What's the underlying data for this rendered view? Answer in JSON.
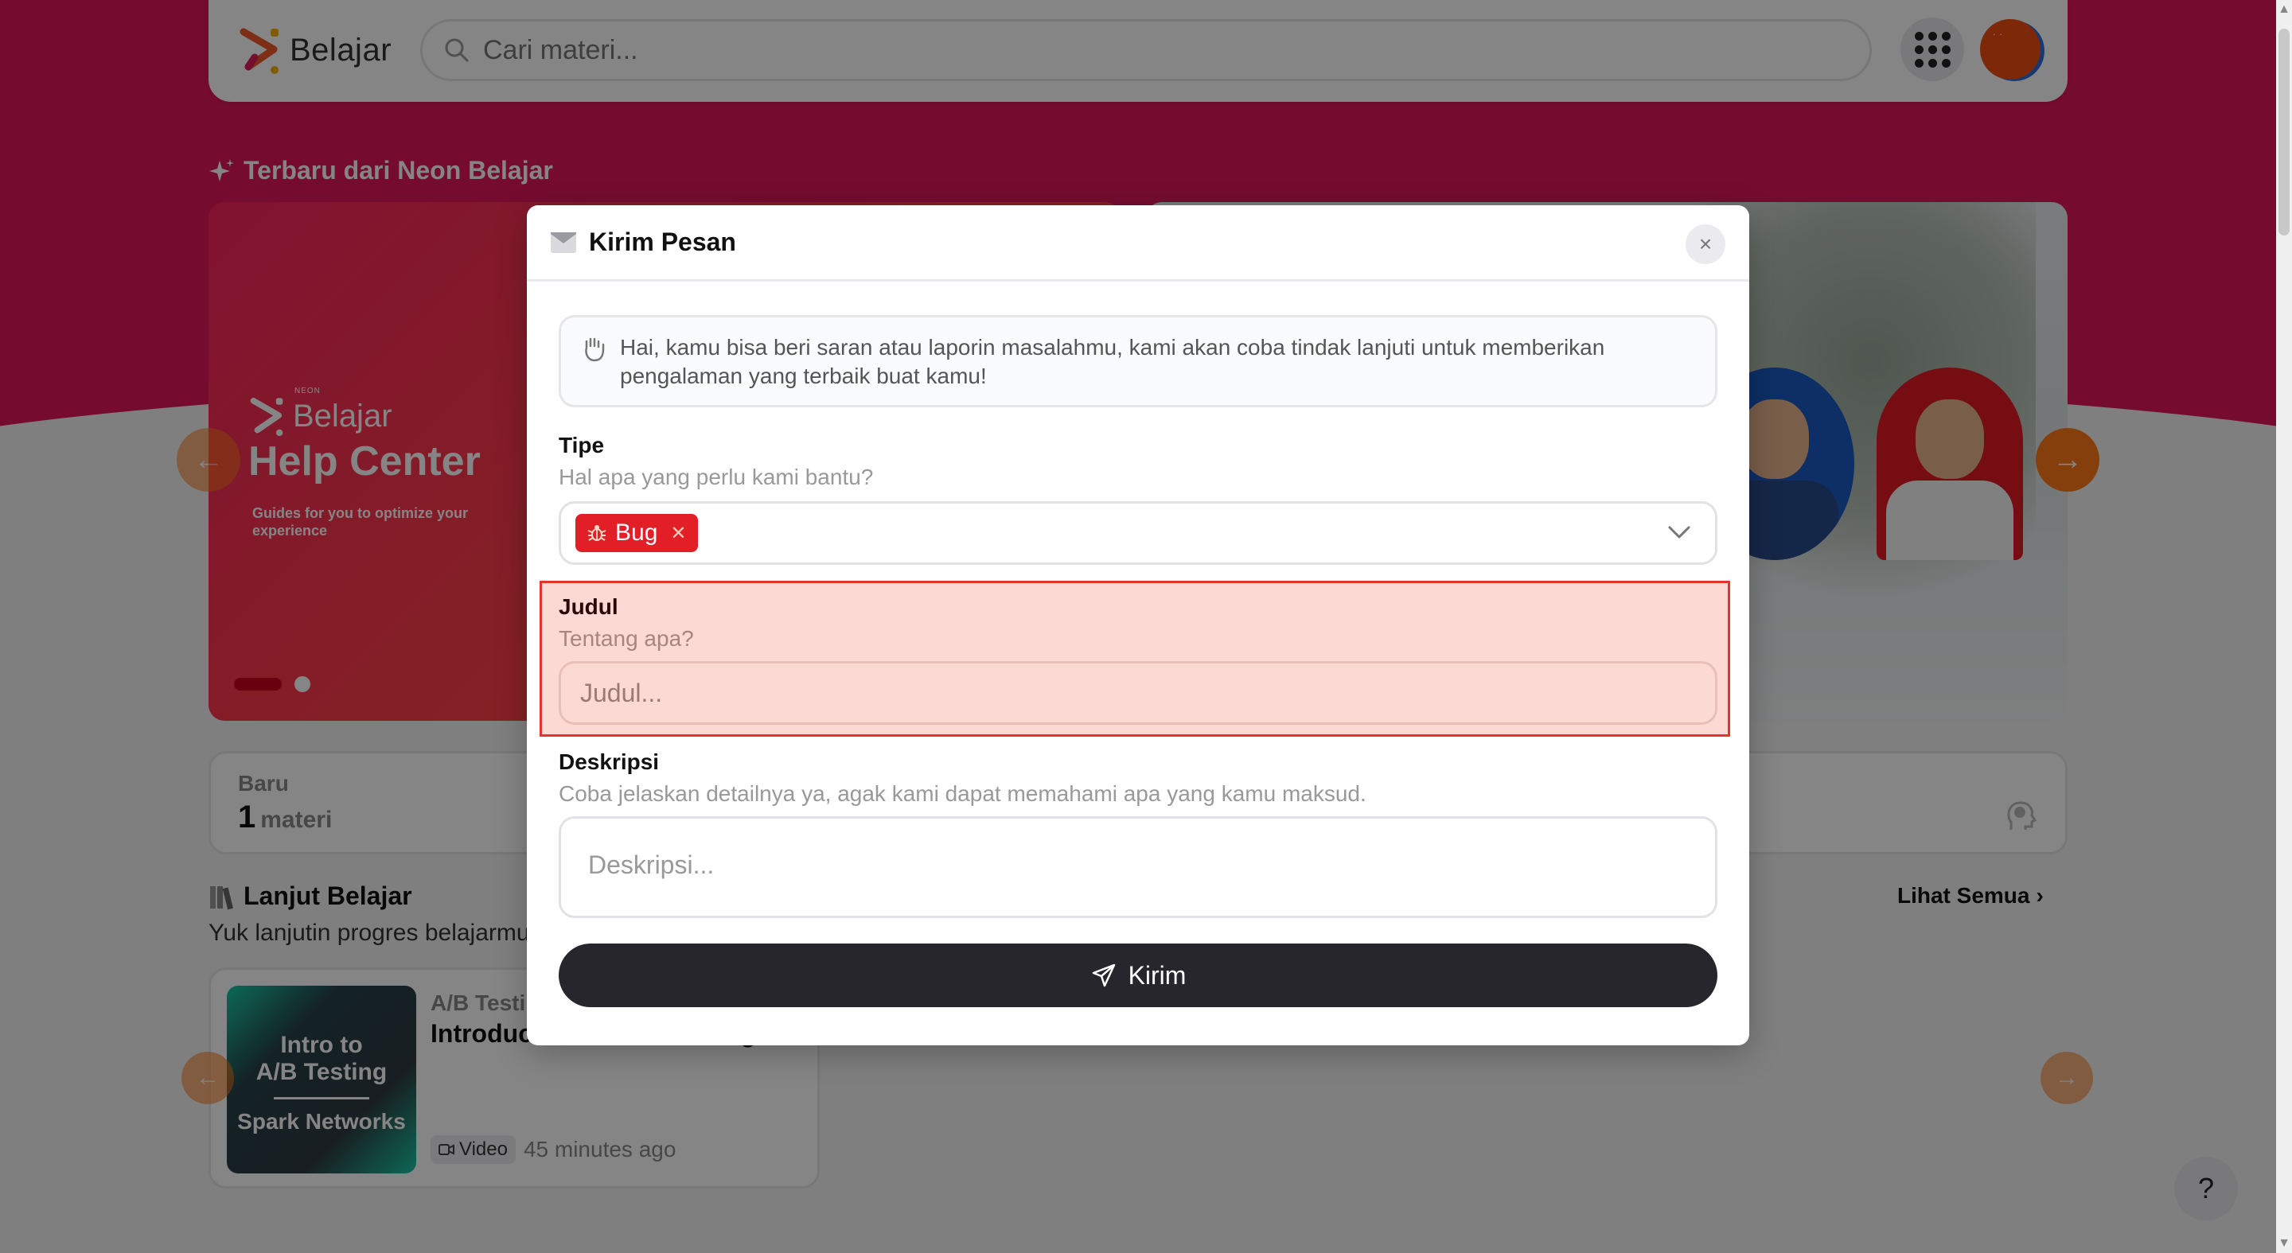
{
  "topbar": {
    "logo_text": "Belajar",
    "search_placeholder": "Cari materi..."
  },
  "hero": {
    "section_title": "Terbaru dari Neon Belajar",
    "help_card": {
      "brand_small": "NEON",
      "brand_name": "Belajar",
      "title": "Help Center",
      "subtitle": "Guides for you to optimize your experience"
    },
    "carousel_slides": 2,
    "active_slide": 1
  },
  "stats": {
    "label": "Baru",
    "value": "1",
    "unit": "materi"
  },
  "lanjut": {
    "title": "Lanjut Belajar",
    "subtitle": "Yuk lanjutin progres belajarmu",
    "see_all": "Lihat Semua",
    "course": {
      "thumb_line1": "Intro to",
      "thumb_line2": "A/B Testing",
      "thumb_line3": "Spark Networks",
      "category": "A/B Testing",
      "title": "Introduction to A/B Testing",
      "type": "Video",
      "time": "45 minutes ago"
    }
  },
  "help_fab": "?",
  "modal": {
    "title": "Kirim Pesan",
    "info": "Hai, kamu bisa beri saran atau laporin masalahmu, kami akan coba tindak lanjuti untuk memberikan pengalaman yang terbaik buat kamu!",
    "tipe": {
      "label": "Tipe",
      "hint": "Hal apa yang perlu kami bantu?",
      "selected": "Bug"
    },
    "judul": {
      "label": "Judul",
      "hint": "Tentang apa?",
      "placeholder": "Judul...",
      "value": ""
    },
    "deskripsi": {
      "label": "Deskripsi",
      "hint": "Coba jelaskan detailnya ya, agak kami dapat memahami apa yang kamu maksud.",
      "placeholder": "Deskripsi...",
      "value": ""
    },
    "submit_label": "Kirim"
  },
  "colors": {
    "brand": "#e0175a",
    "accent_orange": "#ff7a18",
    "chip_red": "#e21f26",
    "error_bg": "#fcd9d3",
    "error_border": "#e0362c",
    "submit_bg": "#26262c"
  }
}
